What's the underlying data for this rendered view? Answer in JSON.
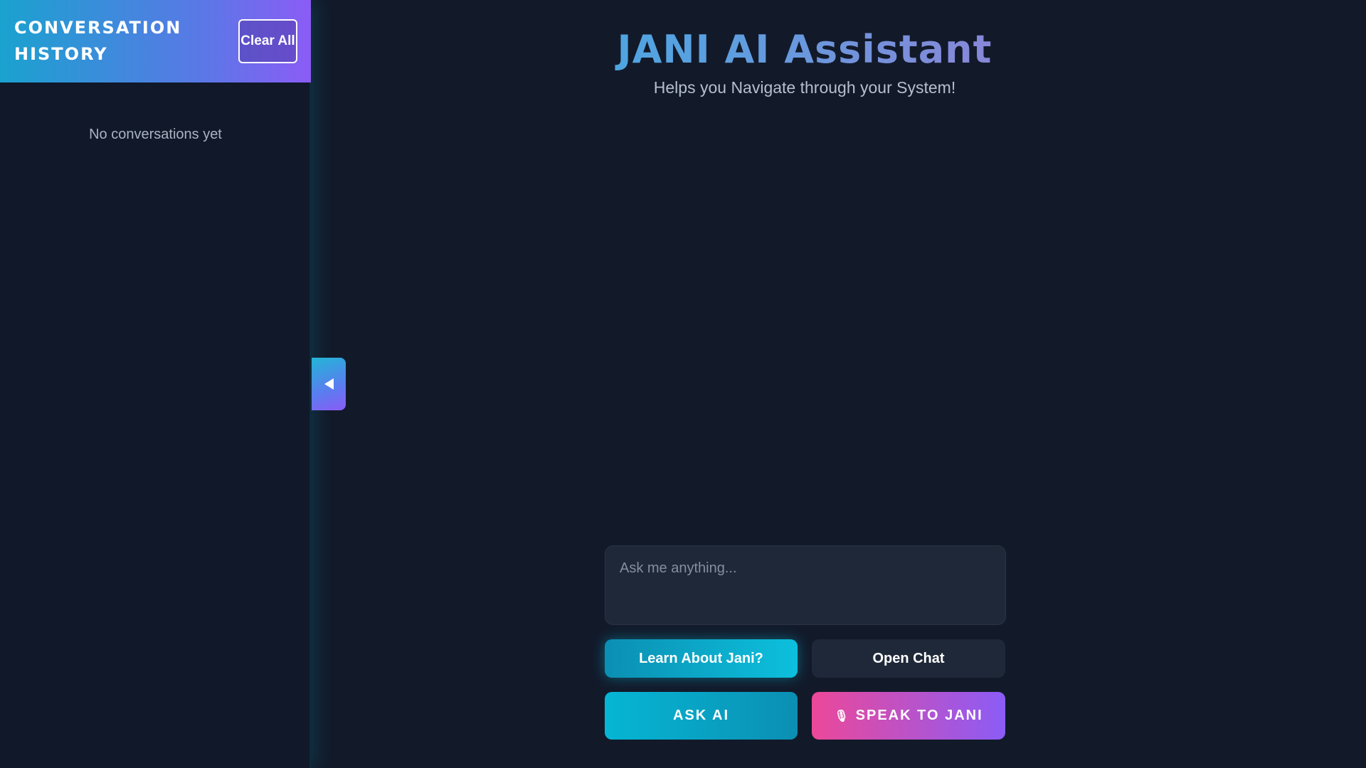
{
  "sidebar": {
    "title": "CONVERSATION HISTORY",
    "clear_all_label": "Clear All",
    "empty_message": "No conversations yet",
    "toggle_icon": "chevron-left-icon"
  },
  "header": {
    "title": "JANI AI Assistant",
    "subtitle": "Helps you Navigate through your System!"
  },
  "input": {
    "placeholder": "Ask me anything...",
    "value": ""
  },
  "buttons": {
    "learn_label": "Learn About Jani?",
    "open_chat_label": "Open Chat",
    "ask_ai_label": "ASK AI",
    "speak_icon": "🎙",
    "speak_label": "SPEAK TO JANI"
  },
  "colors": {
    "background": "#121a2a",
    "accent_cyan": "#06b6d4",
    "accent_purple": "#8b5cf6",
    "accent_pink": "#ec4899"
  }
}
